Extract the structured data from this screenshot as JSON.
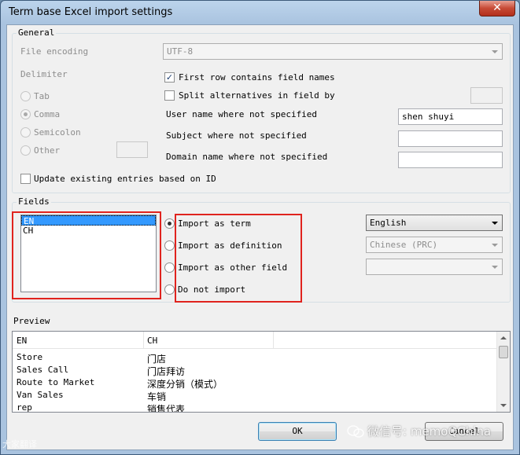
{
  "window": {
    "title": "Term base Excel import settings",
    "close_glyph": "✕"
  },
  "general": {
    "legend": "General",
    "file_encoding_label": "File encoding",
    "file_encoding_value": "UTF-8",
    "delimiter_label": "Delimiter",
    "delimiters": [
      {
        "label": "Tab",
        "selected": false
      },
      {
        "label": "Comma",
        "selected": true
      },
      {
        "label": "Semicolon",
        "selected": false
      },
      {
        "label": "Other",
        "selected": false
      }
    ],
    "first_row_label": "First row contains field names",
    "first_row_checked": true,
    "split_label": "Split alternatives in field by",
    "split_checked": false,
    "user_name_label": "User name where not specified",
    "user_name_value": "shen shuyi",
    "subject_label": "Subject where not specified",
    "subject_value": "",
    "domain_label": "Domain name where not specified",
    "domain_value": "",
    "update_label": "Update existing entries based on ID",
    "update_checked": false
  },
  "fields": {
    "legend": "Fields",
    "items": [
      "EN",
      "CH"
    ],
    "selected_index": 0,
    "import_options": [
      {
        "label": "Import as term",
        "selected": true
      },
      {
        "label": "Import as definition",
        "selected": false
      },
      {
        "label": "Import as other field",
        "selected": false
      },
      {
        "label": "Do not import",
        "selected": false
      }
    ],
    "term_language": "English",
    "definition_language": "Chinese (PRC)",
    "other_field": ""
  },
  "preview": {
    "legend": "Preview",
    "columns": [
      "EN",
      "CH"
    ],
    "rows": [
      [
        "Store",
        "门店"
      ],
      [
        "Sales Call",
        "门店拜访"
      ],
      [
        "Route to Market",
        "深度分销（模式）"
      ],
      [
        "Van Sales",
        "车销"
      ],
      [
        "rep",
        "销售代表"
      ]
    ]
  },
  "buttons": {
    "ok": "OK",
    "cancel": "Cancel"
  },
  "watermark": {
    "text": "微信号: memoQChina",
    "left_text": "大家翻译"
  },
  "colors": {
    "highlight_red": "#e0231e",
    "selection_blue": "#3399ff"
  },
  "icons": {
    "close": "close-icon",
    "dropdown": "chevron-down-icon"
  }
}
